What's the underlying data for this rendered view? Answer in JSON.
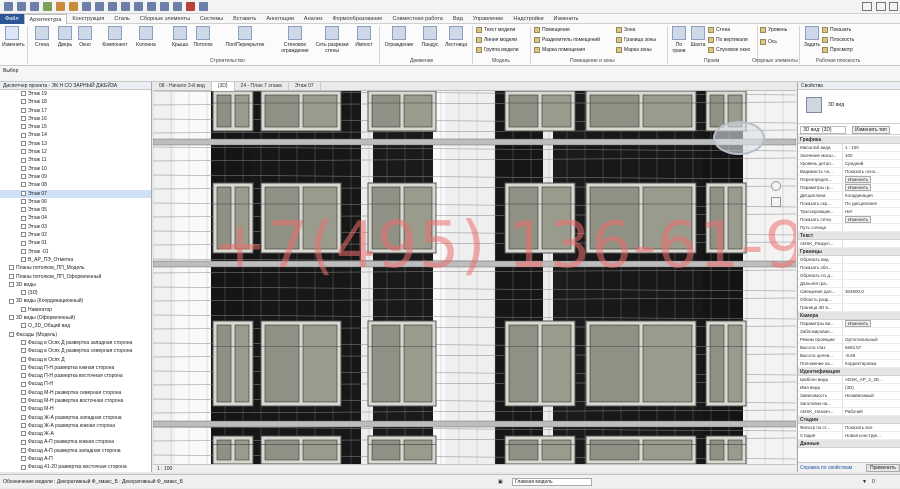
{
  "ribbon_tabs": [
    "Файл",
    "Архитектура",
    "Конструкция",
    "Сталь",
    "Сборные элементы",
    "Системы",
    "Вставить",
    "Аннотации",
    "Анализ",
    "Формообразование",
    "Совместная работа",
    "Вид",
    "Управление",
    "Надстройки",
    "Изменить"
  ],
  "ribbon": {
    "modify": "Изменить",
    "wall": "Стена",
    "door": "Дверь",
    "window": "Окно",
    "component": "Компонент",
    "column": "Колонна",
    "roof": "Крыша",
    "ceiling": "Потолок",
    "floor": "Пол/Перекрытие",
    "curtain_system": "Стеновое ограждение",
    "curtain_grid": "Сеть разрезки стены",
    "mullion": "Импост",
    "railing": "Ограждение",
    "ramp": "Пандус",
    "stair": "Лестница",
    "model_text": "Текст модели",
    "model_line": "Линия модели",
    "model_group": "Группа модели",
    "room": "Помещение",
    "room_separator": "Разделитель помещений",
    "room_tag": "Марка помещения",
    "area": "Зона",
    "area_boundary": "Граница зоны",
    "area_tag": "Марка зоны",
    "by_face": "По грани",
    "shaft": "Шахта",
    "wall_opening": "Стена",
    "vertical": "По вертикали",
    "dormer": "Слуховое окно",
    "level": "Уровень",
    "grid": "Ось",
    "set": "Задать",
    "show": "Показать",
    "ref_plane": "Плоскость",
    "viewer": "Просмотр",
    "panel_select": "Выбор",
    "panel_build": "Строительство",
    "panel_circulation": "Движение",
    "panel_model": "Модель",
    "panel_room": "Помещение и зоны",
    "panel_opening": "Проем",
    "panel_datum": "Опорные элементы",
    "panel_workplane": "Рабочая плоскость"
  },
  "browser": {
    "title": "Диспетчер проекта - ЭК Н СО ЗАРНЫЙ ДЖЕЙЗА",
    "items": [
      {
        "label": "Этаж 19",
        "indent": 3,
        "selected": false
      },
      {
        "label": "Этаж 18",
        "indent": 3,
        "selected": false
      },
      {
        "label": "Этаж 17",
        "indent": 3,
        "selected": false
      },
      {
        "label": "Этаж 16",
        "indent": 3,
        "selected": false
      },
      {
        "label": "Этаж 15",
        "indent": 3,
        "selected": false
      },
      {
        "label": "Этаж 14",
        "indent": 3,
        "selected": false
      },
      {
        "label": "Этаж 13",
        "indent": 3,
        "selected": false
      },
      {
        "label": "Этаж 12",
        "indent": 3,
        "selected": false
      },
      {
        "label": "Этаж 11",
        "indent": 3,
        "selected": false
      },
      {
        "label": "Этаж 10",
        "indent": 3,
        "selected": false
      },
      {
        "label": "Этаж 09",
        "indent": 3,
        "selected": false
      },
      {
        "label": "Этаж 08",
        "indent": 3,
        "selected": false
      },
      {
        "label": "Этаж 07",
        "indent": 3,
        "selected": true
      },
      {
        "label": "Этаж 06",
        "indent": 3,
        "selected": false
      },
      {
        "label": "Этаж 05",
        "indent": 3,
        "selected": false
      },
      {
        "label": "Этаж 04",
        "indent": 3,
        "selected": false
      },
      {
        "label": "Этаж 03",
        "indent": 3,
        "selected": false
      },
      {
        "label": "Этаж 02",
        "indent": 3,
        "selected": false
      },
      {
        "label": "Этаж 01",
        "indent": 3,
        "selected": false
      },
      {
        "label": "Этаж -01",
        "indent": 3,
        "selected": false
      },
      {
        "label": "В_АР_ПЭ_Отметка",
        "indent": 3,
        "selected": false
      },
      {
        "label": "Планы потолков_ПП_Модель",
        "indent": 1,
        "selected": false
      },
      {
        "label": "Планы потолков_ПП_Оформленный",
        "indent": 1,
        "selected": false
      },
      {
        "label": "3D виды",
        "indent": 1,
        "selected": false
      },
      {
        "label": "{3D}",
        "indent": 3,
        "selected": false
      },
      {
        "label": "3D виды (Координационный)",
        "indent": 1,
        "selected": false
      },
      {
        "label": "Навигатор",
        "indent": 3,
        "selected": false
      },
      {
        "label": "3D виды (Оформленный)",
        "indent": 1,
        "selected": false
      },
      {
        "label": "О_3D_Общий вид",
        "indent": 3,
        "selected": false
      },
      {
        "label": "Фасады (Модель)",
        "indent": 1,
        "selected": false
      },
      {
        "label": "Фасад в Осях Д развертка западная сторона",
        "indent": 3,
        "selected": false
      },
      {
        "label": "Фасад в Осях Д развертка северная сторона",
        "indent": 3,
        "selected": false
      },
      {
        "label": "Фасад в Осях Д",
        "indent": 3,
        "selected": false
      },
      {
        "label": "Фасад П-Н развертка южная сторона",
        "indent": 3,
        "selected": false
      },
      {
        "label": "Фасад П-Н развертка восточная сторона",
        "indent": 3,
        "selected": false
      },
      {
        "label": "Фасад П-Н",
        "indent": 3,
        "selected": false
      },
      {
        "label": "Фасад М-Н развертка северная сторона",
        "indent": 3,
        "selected": false
      },
      {
        "label": "Фасад М-Н развертка восточная сторона",
        "indent": 3,
        "selected": false
      },
      {
        "label": "Фасад М-Н",
        "indent": 3,
        "selected": false
      },
      {
        "label": "Фасад Ж-А развертка западная сторона",
        "indent": 3,
        "selected": false
      },
      {
        "label": "Фасад Ж-А развертка южная сторона",
        "indent": 3,
        "selected": false
      },
      {
        "label": "Фасад Ж-А",
        "indent": 3,
        "selected": false
      },
      {
        "label": "Фасад А-П развертка южная сторона",
        "indent": 3,
        "selected": false
      },
      {
        "label": "Фасад А-П развертка западная сторона",
        "indent": 3,
        "selected": false
      },
      {
        "label": "Фасад А-П",
        "indent": 3,
        "selected": false
      },
      {
        "label": "Фасад 41-20 развертка восточная сторона",
        "indent": 3,
        "selected": false
      }
    ]
  },
  "view_tabs": [
    {
      "label": "08 - Начало 3-й вид",
      "active": false
    },
    {
      "label": "{3D}",
      "active": true
    },
    {
      "label": "24 - План 7 этажа",
      "active": false
    },
    {
      "label": "Этаж 07",
      "active": false
    }
  ],
  "canvas": {
    "watermark": "+7(495) 136-61-94",
    "view_scale": "1 : 100"
  },
  "properties": {
    "title": "Свойства",
    "type_name": "3D вид",
    "selector": "3D вид: {3D}",
    "edit_type": "Изменить тип",
    "groups": [
      {
        "name": "Графика",
        "rows": [
          {
            "k": "Масштаб вида",
            "v": "1 : 100"
          },
          {
            "k": "Значение масш...",
            "v": "100"
          },
          {
            "k": "Уровень детал...",
            "v": "Средний"
          },
          {
            "k": "Видимость ча...",
            "v": "Показать осно..."
          },
          {
            "k": "Переопредел...",
            "v": "Изменить",
            "button": true
          },
          {
            "k": "Параметры гр...",
            "v": "Изменить",
            "button": true
          },
          {
            "k": "Дисциплина",
            "v": "Координация"
          },
          {
            "k": "Показать скр...",
            "v": "По дисциплине"
          },
          {
            "k": "Трассировщик...",
            "v": "Нет"
          },
          {
            "k": "Показать сетку",
            "v": "Изменить",
            "button": true
          },
          {
            "k": "Путь солнца",
            "v": ""
          }
        ]
      },
      {
        "name": "Текст",
        "rows": [
          {
            "k": "ADSK_Раздел...",
            "v": ""
          }
        ]
      },
      {
        "name": "Границы",
        "rows": [
          {
            "k": "Обрезать вид",
            "v": ""
          },
          {
            "k": "Показать обл...",
            "v": ""
          },
          {
            "k": "Обрезать по д...",
            "v": ""
          },
          {
            "k": "Дальняя гра...",
            "v": ""
          },
          {
            "k": "Смещение дал...",
            "v": "304800.0"
          },
          {
            "k": "Область разр...",
            "v": ""
          },
          {
            "k": "Граница 3D в...",
            "v": ""
          }
        ]
      },
      {
        "name": "Камера",
        "rows": [
          {
            "k": "Параметры ви...",
            "v": "Изменить",
            "button": true
          },
          {
            "k": "Заблокирован...",
            "v": ""
          },
          {
            "k": "Режим проекции",
            "v": "Ортогональный"
          },
          {
            "k": "Высота глаз",
            "v": "6692.57"
          },
          {
            "k": "Высота целев...",
            "v": "-9.69"
          },
          {
            "k": "Положение ка...",
            "v": "Корректировка"
          }
        ]
      },
      {
        "name": "Идентификация",
        "rows": [
          {
            "k": "Шаблон вида",
            "v": "ADSK_АР_3_3D..."
          },
          {
            "k": "Имя вида",
            "v": "{3D}"
          },
          {
            "k": "Зависимость",
            "v": "Независимый"
          },
          {
            "k": "Заголовок на...",
            "v": ""
          },
          {
            "k": "ADSK_Назнач...",
            "v": "Рабочий"
          }
        ]
      },
      {
        "name": "Стадии",
        "rows": [
          {
            "k": "Фильтр по ст...",
            "v": "Показать все"
          },
          {
            "k": "Стадия",
            "v": "Новая конструк..."
          }
        ]
      },
      {
        "name": "Данные",
        "rows": []
      }
    ],
    "footer_link": "Справка по свойствам",
    "apply": "Применить"
  },
  "status_bar": {
    "hint": "Обозначение модели : Декоративный Ф_хмакс_Б : Декоративный Ф_хмакс_Б",
    "model": "Главная модель",
    "scale": "0"
  }
}
